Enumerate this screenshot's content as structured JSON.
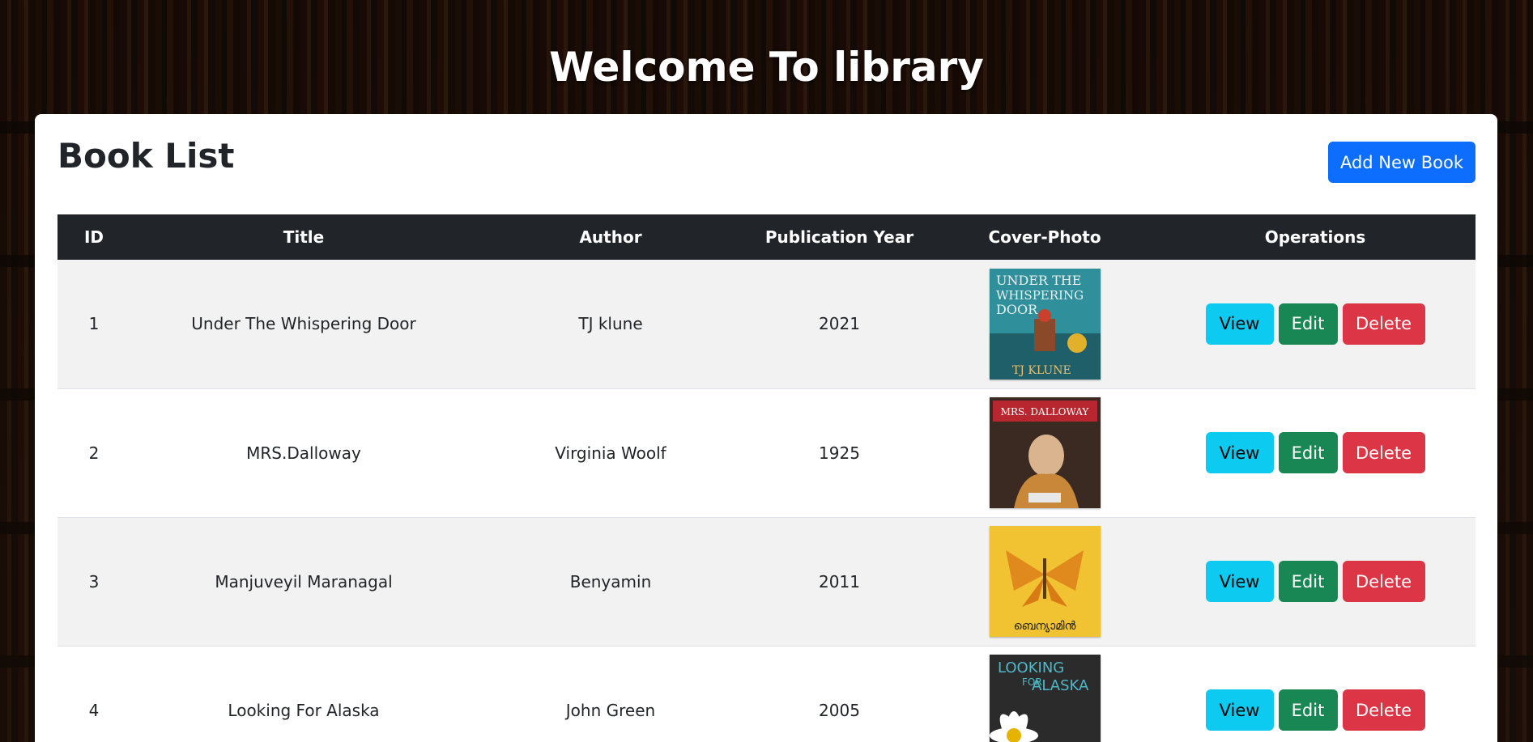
{
  "header": {
    "welcome": "Welcome To library"
  },
  "card": {
    "title": "Book List",
    "add_button": "Add New Book"
  },
  "table": {
    "columns": [
      "ID",
      "Title",
      "Author",
      "Publication Year",
      "Cover-Photo",
      "Operations"
    ],
    "rows": [
      {
        "id": "1",
        "title": "Under The Whispering Door",
        "author": "TJ klune",
        "year": "2021",
        "cover": {
          "top": "UNDER THE",
          "mid": "WHISPERING",
          "low": "DOOR",
          "bottom": "TJ KLUNE"
        }
      },
      {
        "id": "2",
        "title": "MRS.Dalloway",
        "author": "Virginia Woolf",
        "year": "1925",
        "cover": {
          "top": "MRS. DALLOWAY"
        }
      },
      {
        "id": "3",
        "title": "Manjuveyil Maranagal",
        "author": "Benyamin",
        "year": "2011",
        "cover": {
          "bottom": "ബെന്യാമിൻ"
        }
      },
      {
        "id": "4",
        "title": "Looking For Alaska",
        "author": "John Green",
        "year": "2005",
        "cover": {
          "top": "LOOKING",
          "mid": "FOR",
          "low": "ALASKA"
        }
      }
    ],
    "buttons": {
      "view": "View",
      "edit": "Edit",
      "delete": "Delete"
    }
  },
  "colors": {
    "primary": "#0d6efd",
    "info": "#0dcaf0",
    "success": "#198754",
    "danger": "#dc3545",
    "header_dark": "#212529"
  }
}
